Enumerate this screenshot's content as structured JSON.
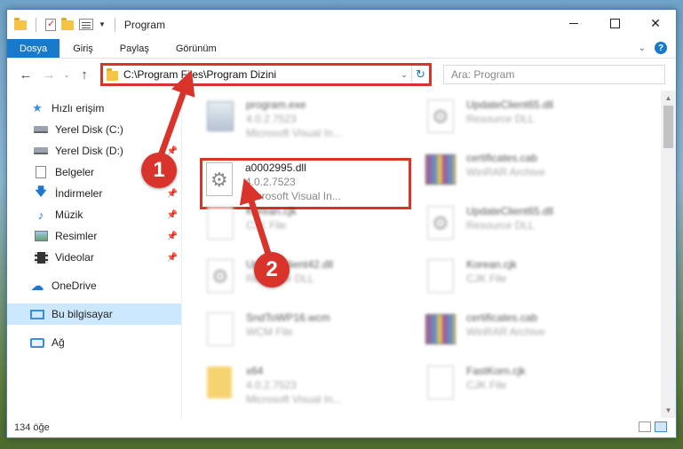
{
  "window": {
    "title": "Program"
  },
  "ribbon": {
    "tabs": [
      "Dosya",
      "Giriş",
      "Paylaş",
      "Görünüm"
    ]
  },
  "address": {
    "path": "C:\\Program Files\\Program Dizini",
    "search_placeholder": "Ara: Program"
  },
  "nav": {
    "items": [
      {
        "label": "Hızlı erişim",
        "icon": "star-icon"
      },
      {
        "label": "Yerel Disk (C:)",
        "icon": "disk-icon"
      },
      {
        "label": "Yerel Disk (D:)",
        "icon": "disk-icon"
      },
      {
        "label": "Belgeler",
        "icon": "documents-icon"
      },
      {
        "label": "İndirmeler",
        "icon": "download-icon"
      },
      {
        "label": "Müzik",
        "icon": "music-icon"
      },
      {
        "label": "Resimler",
        "icon": "pictures-icon"
      },
      {
        "label": "Videolar",
        "icon": "video-icon"
      },
      {
        "label": "OneDrive",
        "icon": "cloud-icon"
      },
      {
        "label": "Bu bilgisayar",
        "icon": "computer-icon"
      },
      {
        "label": "Ağ",
        "icon": "network-icon"
      }
    ]
  },
  "files": {
    "left": [
      {
        "name": "program.exe",
        "line2": "4.0.2.7523",
        "line3": "Microsoft Visual In..."
      },
      {
        "name": "a0002995.dll",
        "line2": "4.0.2.7523",
        "line3": "Microsoft Visual In..."
      },
      {
        "name": "Korean.cjk",
        "line2": "CJK File"
      },
      {
        "name": "UpdateClient42.dll",
        "line2": "Resource DLL"
      },
      {
        "name": "SndToWP16.wcm",
        "line2": "WCM File"
      },
      {
        "name": "x64",
        "line2": "4.0.2.7523",
        "line3": "Microsoft Visual In..."
      }
    ],
    "right": [
      {
        "name": "UpdateClient65.dll",
        "line2": "Resource DLL"
      },
      {
        "name": "certificates.cab",
        "line2": "WinRAR Archive"
      },
      {
        "name": "UpdateClient65.dll",
        "line2": "Resource DLL"
      },
      {
        "name": "Korean.cjk",
        "line2": "CJK File"
      },
      {
        "name": "certificates.cab",
        "line2": "WinRAR Archive"
      },
      {
        "name": "FastKorn.cjk",
        "line2": "CJK File"
      }
    ]
  },
  "status": {
    "count": "134 öğe"
  },
  "annotations": {
    "step1": "1",
    "step2": "2",
    "color": "#d9342b"
  }
}
